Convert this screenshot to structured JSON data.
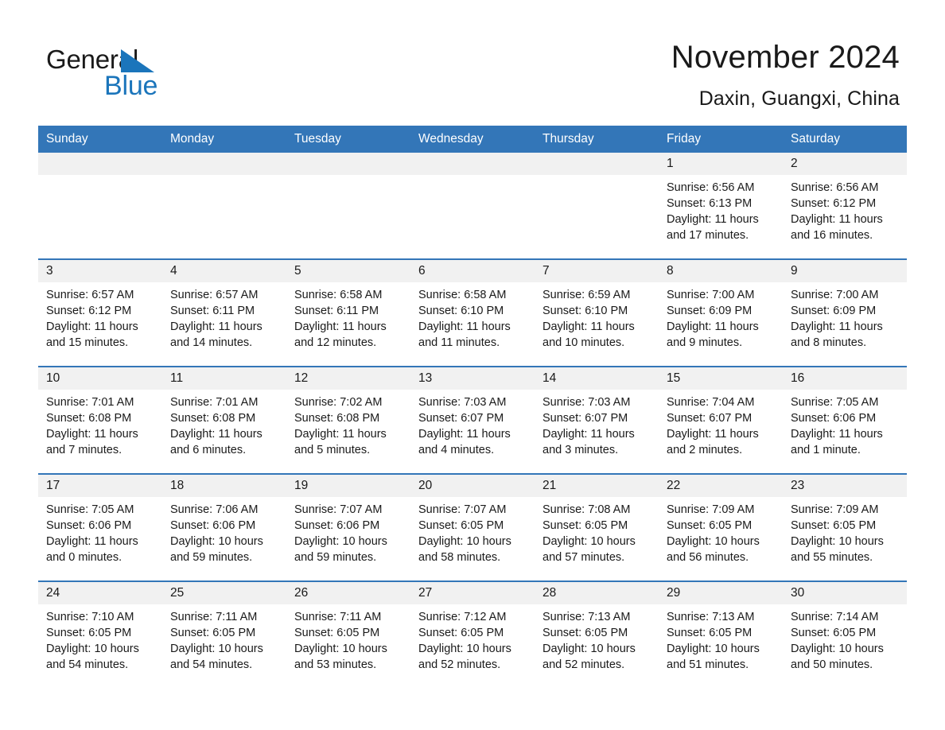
{
  "logo": {
    "word_one": "General",
    "word_two": "Blue",
    "triangle_color": "#1b75bb"
  },
  "header": {
    "title": "November 2024",
    "subtitle": "Daxin, Guangxi, China"
  },
  "theme": {
    "header_blue": "#3376b8",
    "daynum_band": "#f1f1f1",
    "text": "#1a1a1a"
  },
  "weekdays": [
    "Sunday",
    "Monday",
    "Tuesday",
    "Wednesday",
    "Thursday",
    "Friday",
    "Saturday"
  ],
  "weeks": [
    [
      {
        "day": "",
        "sunrise": "",
        "sunset": "",
        "daylight": "",
        "empty": true
      },
      {
        "day": "",
        "sunrise": "",
        "sunset": "",
        "daylight": "",
        "empty": true
      },
      {
        "day": "",
        "sunrise": "",
        "sunset": "",
        "daylight": "",
        "empty": true
      },
      {
        "day": "",
        "sunrise": "",
        "sunset": "",
        "daylight": "",
        "empty": true
      },
      {
        "day": "",
        "sunrise": "",
        "sunset": "",
        "daylight": "",
        "empty": true
      },
      {
        "day": "1",
        "sunrise": "Sunrise: 6:56 AM",
        "sunset": "Sunset: 6:13 PM",
        "daylight": "Daylight: 11 hours and 17 minutes.",
        "empty": false
      },
      {
        "day": "2",
        "sunrise": "Sunrise: 6:56 AM",
        "sunset": "Sunset: 6:12 PM",
        "daylight": "Daylight: 11 hours and 16 minutes.",
        "empty": false
      }
    ],
    [
      {
        "day": "3",
        "sunrise": "Sunrise: 6:57 AM",
        "sunset": "Sunset: 6:12 PM",
        "daylight": "Daylight: 11 hours and 15 minutes.",
        "empty": false
      },
      {
        "day": "4",
        "sunrise": "Sunrise: 6:57 AM",
        "sunset": "Sunset: 6:11 PM",
        "daylight": "Daylight: 11 hours and 14 minutes.",
        "empty": false
      },
      {
        "day": "5",
        "sunrise": "Sunrise: 6:58 AM",
        "sunset": "Sunset: 6:11 PM",
        "daylight": "Daylight: 11 hours and 12 minutes.",
        "empty": false
      },
      {
        "day": "6",
        "sunrise": "Sunrise: 6:58 AM",
        "sunset": "Sunset: 6:10 PM",
        "daylight": "Daylight: 11 hours and 11 minutes.",
        "empty": false
      },
      {
        "day": "7",
        "sunrise": "Sunrise: 6:59 AM",
        "sunset": "Sunset: 6:10 PM",
        "daylight": "Daylight: 11 hours and 10 minutes.",
        "empty": false
      },
      {
        "day": "8",
        "sunrise": "Sunrise: 7:00 AM",
        "sunset": "Sunset: 6:09 PM",
        "daylight": "Daylight: 11 hours and 9 minutes.",
        "empty": false
      },
      {
        "day": "9",
        "sunrise": "Sunrise: 7:00 AM",
        "sunset": "Sunset: 6:09 PM",
        "daylight": "Daylight: 11 hours and 8 minutes.",
        "empty": false
      }
    ],
    [
      {
        "day": "10",
        "sunrise": "Sunrise: 7:01 AM",
        "sunset": "Sunset: 6:08 PM",
        "daylight": "Daylight: 11 hours and 7 minutes.",
        "empty": false
      },
      {
        "day": "11",
        "sunrise": "Sunrise: 7:01 AM",
        "sunset": "Sunset: 6:08 PM",
        "daylight": "Daylight: 11 hours and 6 minutes.",
        "empty": false
      },
      {
        "day": "12",
        "sunrise": "Sunrise: 7:02 AM",
        "sunset": "Sunset: 6:08 PM",
        "daylight": "Daylight: 11 hours and 5 minutes.",
        "empty": false
      },
      {
        "day": "13",
        "sunrise": "Sunrise: 7:03 AM",
        "sunset": "Sunset: 6:07 PM",
        "daylight": "Daylight: 11 hours and 4 minutes.",
        "empty": false
      },
      {
        "day": "14",
        "sunrise": "Sunrise: 7:03 AM",
        "sunset": "Sunset: 6:07 PM",
        "daylight": "Daylight: 11 hours and 3 minutes.",
        "empty": false
      },
      {
        "day": "15",
        "sunrise": "Sunrise: 7:04 AM",
        "sunset": "Sunset: 6:07 PM",
        "daylight": "Daylight: 11 hours and 2 minutes.",
        "empty": false
      },
      {
        "day": "16",
        "sunrise": "Sunrise: 7:05 AM",
        "sunset": "Sunset: 6:06 PM",
        "daylight": "Daylight: 11 hours and 1 minute.",
        "empty": false
      }
    ],
    [
      {
        "day": "17",
        "sunrise": "Sunrise: 7:05 AM",
        "sunset": "Sunset: 6:06 PM",
        "daylight": "Daylight: 11 hours and 0 minutes.",
        "empty": false
      },
      {
        "day": "18",
        "sunrise": "Sunrise: 7:06 AM",
        "sunset": "Sunset: 6:06 PM",
        "daylight": "Daylight: 10 hours and 59 minutes.",
        "empty": false
      },
      {
        "day": "19",
        "sunrise": "Sunrise: 7:07 AM",
        "sunset": "Sunset: 6:06 PM",
        "daylight": "Daylight: 10 hours and 59 minutes.",
        "empty": false
      },
      {
        "day": "20",
        "sunrise": "Sunrise: 7:07 AM",
        "sunset": "Sunset: 6:05 PM",
        "daylight": "Daylight: 10 hours and 58 minutes.",
        "empty": false
      },
      {
        "day": "21",
        "sunrise": "Sunrise: 7:08 AM",
        "sunset": "Sunset: 6:05 PM",
        "daylight": "Daylight: 10 hours and 57 minutes.",
        "empty": false
      },
      {
        "day": "22",
        "sunrise": "Sunrise: 7:09 AM",
        "sunset": "Sunset: 6:05 PM",
        "daylight": "Daylight: 10 hours and 56 minutes.",
        "empty": false
      },
      {
        "day": "23",
        "sunrise": "Sunrise: 7:09 AM",
        "sunset": "Sunset: 6:05 PM",
        "daylight": "Daylight: 10 hours and 55 minutes.",
        "empty": false
      }
    ],
    [
      {
        "day": "24",
        "sunrise": "Sunrise: 7:10 AM",
        "sunset": "Sunset: 6:05 PM",
        "daylight": "Daylight: 10 hours and 54 minutes.",
        "empty": false
      },
      {
        "day": "25",
        "sunrise": "Sunrise: 7:11 AM",
        "sunset": "Sunset: 6:05 PM",
        "daylight": "Daylight: 10 hours and 54 minutes.",
        "empty": false
      },
      {
        "day": "26",
        "sunrise": "Sunrise: 7:11 AM",
        "sunset": "Sunset: 6:05 PM",
        "daylight": "Daylight: 10 hours and 53 minutes.",
        "empty": false
      },
      {
        "day": "27",
        "sunrise": "Sunrise: 7:12 AM",
        "sunset": "Sunset: 6:05 PM",
        "daylight": "Daylight: 10 hours and 52 minutes.",
        "empty": false
      },
      {
        "day": "28",
        "sunrise": "Sunrise: 7:13 AM",
        "sunset": "Sunset: 6:05 PM",
        "daylight": "Daylight: 10 hours and 52 minutes.",
        "empty": false
      },
      {
        "day": "29",
        "sunrise": "Sunrise: 7:13 AM",
        "sunset": "Sunset: 6:05 PM",
        "daylight": "Daylight: 10 hours and 51 minutes.",
        "empty": false
      },
      {
        "day": "30",
        "sunrise": "Sunrise: 7:14 AM",
        "sunset": "Sunset: 6:05 PM",
        "daylight": "Daylight: 10 hours and 50 minutes.",
        "empty": false
      }
    ]
  ]
}
